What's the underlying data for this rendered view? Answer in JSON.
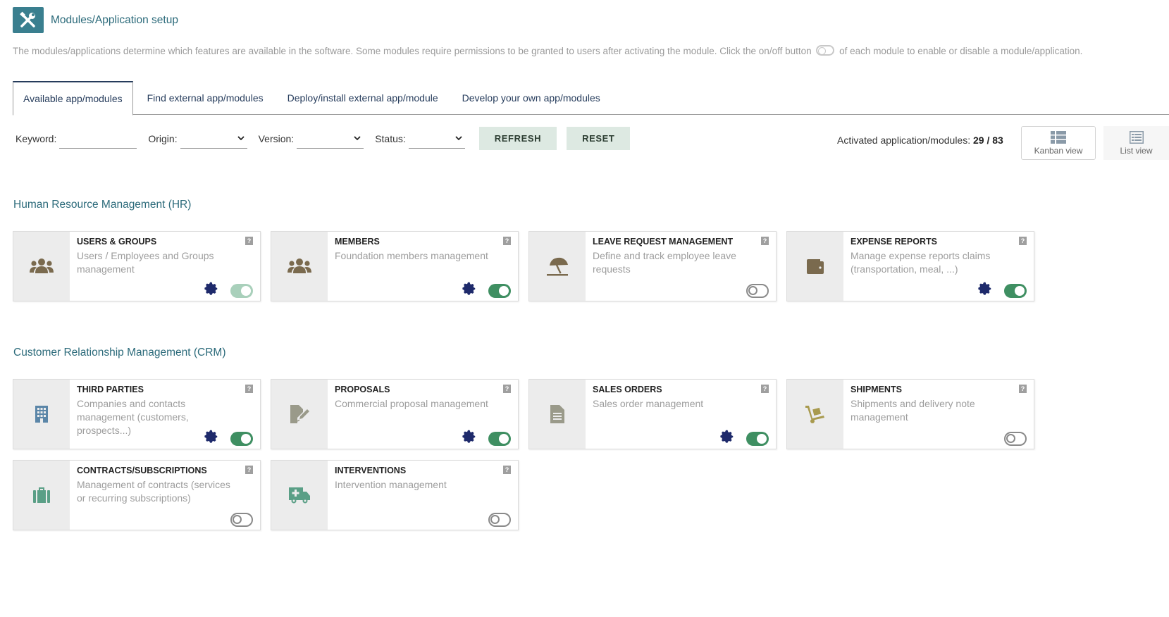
{
  "header": {
    "title": "Modules/Application setup",
    "icon": "tools-icon",
    "accent_color": "#3a7f8f"
  },
  "description": {
    "before_toggle": "The modules/applications determine which features are available in the software. Some modules require permissions to be granted to users after activating the module. Click the on/off button",
    "after_toggle": "of each module to enable or disable a module/application."
  },
  "tabs": [
    {
      "label": "Available app/modules",
      "active": true
    },
    {
      "label": "Find external app/modules",
      "active": false
    },
    {
      "label": "Deploy/install external app/module",
      "active": false
    },
    {
      "label": "Develop your own app/modules",
      "active": false
    }
  ],
  "filters": {
    "keyword_label": "Keyword:",
    "keyword_value": "",
    "origin_label": "Origin:",
    "origin_value": "",
    "version_label": "Version:",
    "version_value": "",
    "status_label": "Status:",
    "status_value": "",
    "refresh_label": "REFRESH",
    "reset_label": "RESET"
  },
  "activated": {
    "label": "Activated application/modules:",
    "count": "29",
    "separator": "/",
    "total": "83"
  },
  "views": {
    "kanban_label": "Kanban view",
    "list_label": "List view"
  },
  "sections": [
    {
      "title": "Human Resource Management (HR)",
      "modules": [
        {
          "name": "USERS & GROUPS",
          "description": "Users / Employees and Groups management",
          "icon": "users-icon",
          "icon_color": "#7a6a4e",
          "has_settings": true,
          "status": "on-faded"
        },
        {
          "name": "MEMBERS",
          "description": "Foundation members management",
          "icon": "users-icon",
          "icon_color": "#7a6a4e",
          "has_settings": true,
          "status": "on"
        },
        {
          "name": "LEAVE REQUEST MANAGEMENT",
          "description": "Define and track employee leave requests",
          "icon": "umbrella-beach-icon",
          "icon_color": "#7a6a4e",
          "has_settings": false,
          "status": "off"
        },
        {
          "name": "EXPENSE REPORTS",
          "description": "Manage expense reports claims (transportation, meal, ...)",
          "icon": "wallet-icon",
          "icon_color": "#7a6a4e",
          "has_settings": true,
          "status": "on"
        }
      ]
    },
    {
      "title": "Customer Relationship Management (CRM)",
      "modules": [
        {
          "name": "THIRD PARTIES",
          "description": "Companies and contacts management (customers, prospects...)",
          "icon": "building-icon",
          "icon_color": "#5b86a8",
          "has_settings": true,
          "status": "on"
        },
        {
          "name": "PROPOSALS",
          "description": "Commercial proposal management",
          "icon": "file-signature-icon",
          "icon_color": "#9a9a8a",
          "has_settings": true,
          "status": "on"
        },
        {
          "name": "SALES ORDERS",
          "description": "Sales order management",
          "icon": "file-text-icon",
          "icon_color": "#9a9a8a",
          "has_settings": true,
          "status": "on"
        },
        {
          "name": "SHIPMENTS",
          "description": "Shipments and delivery note management",
          "icon": "dolly-icon",
          "icon_color": "#a89a4e",
          "has_settings": false,
          "status": "off"
        },
        {
          "name": "CONTRACTS/SUBSCRIPTIONS",
          "description": "Management of contracts (services or recurring subscriptions)",
          "icon": "suitcase-icon",
          "icon_color": "#5a9f86",
          "has_settings": false,
          "status": "off"
        },
        {
          "name": "INTERVENTIONS",
          "description": "Intervention management",
          "icon": "ambulance-icon",
          "icon_color": "#5a9f86",
          "has_settings": false,
          "status": "off"
        }
      ]
    }
  ],
  "help_glyph": "?"
}
